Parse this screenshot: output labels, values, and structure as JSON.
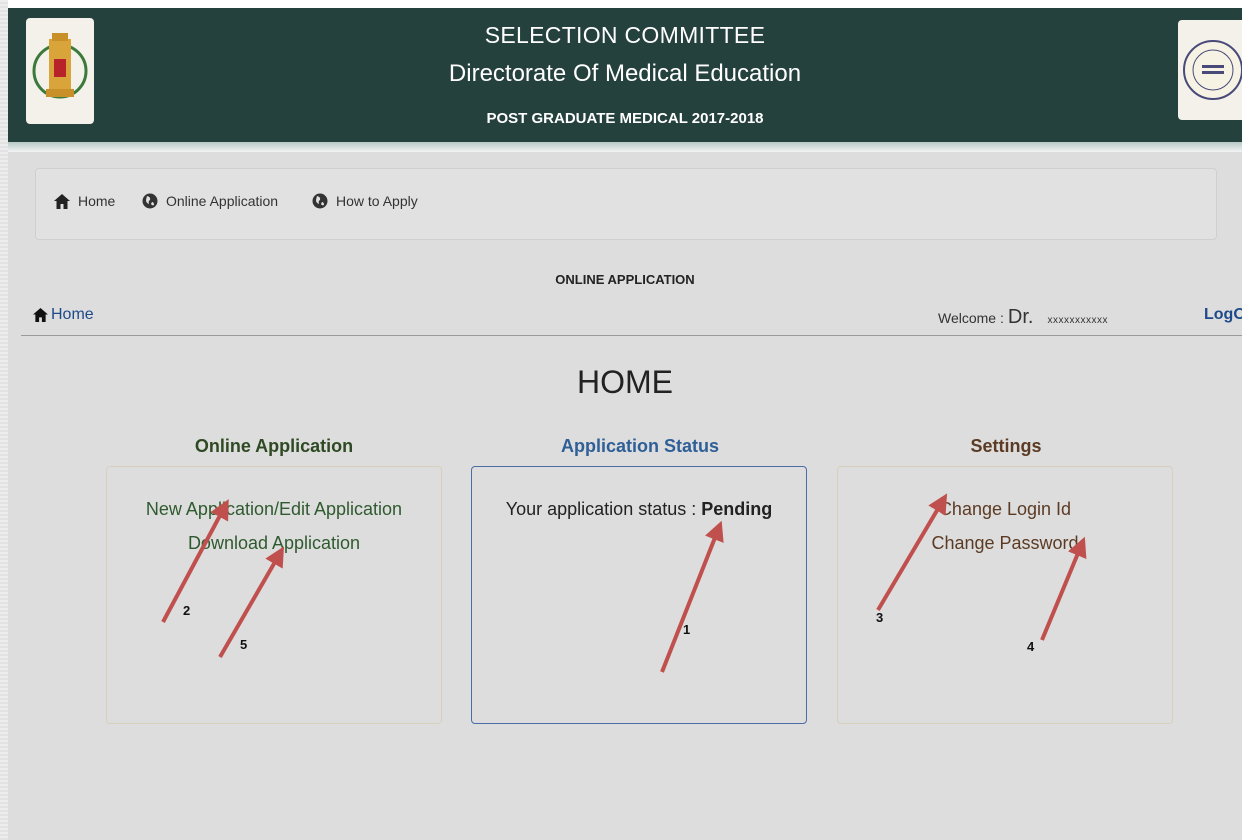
{
  "header": {
    "line1": "SELECTION COMMITTEE",
    "line2": "Directorate Of Medical Education",
    "line3": "POST GRADUATE MEDICAL 2017-2018",
    "colors": {
      "background": "#25413d",
      "text": "#ffffff"
    }
  },
  "nav": {
    "items": [
      {
        "label": "Home",
        "icon": "home-icon"
      },
      {
        "label": "Online Application",
        "icon": "globe-icon"
      },
      {
        "label": "How to Apply",
        "icon": "globe-icon"
      }
    ]
  },
  "page": {
    "section_caption": "ONLINE APPLICATION",
    "breadcrumb": "Home",
    "welcome_label": "Welcome :",
    "welcome_title": "Dr.",
    "user_name": "xxxxxxxxxxx",
    "logoff": "LogOff",
    "title": "HOME"
  },
  "columns": {
    "online": {
      "title": "Online Application",
      "links": [
        "New Application/Edit Application",
        "Download Application"
      ]
    },
    "status": {
      "title": "Application Status",
      "label": "Your application status : ",
      "value": "Pending"
    },
    "settings": {
      "title": "Settings",
      "links": [
        "Change Login Id",
        "Change Password"
      ]
    }
  },
  "annotations": [
    "1",
    "2",
    "3",
    "4",
    "5"
  ],
  "colors": {
    "arrow": "#c0504d",
    "link_blue": "#1d4a8a"
  }
}
